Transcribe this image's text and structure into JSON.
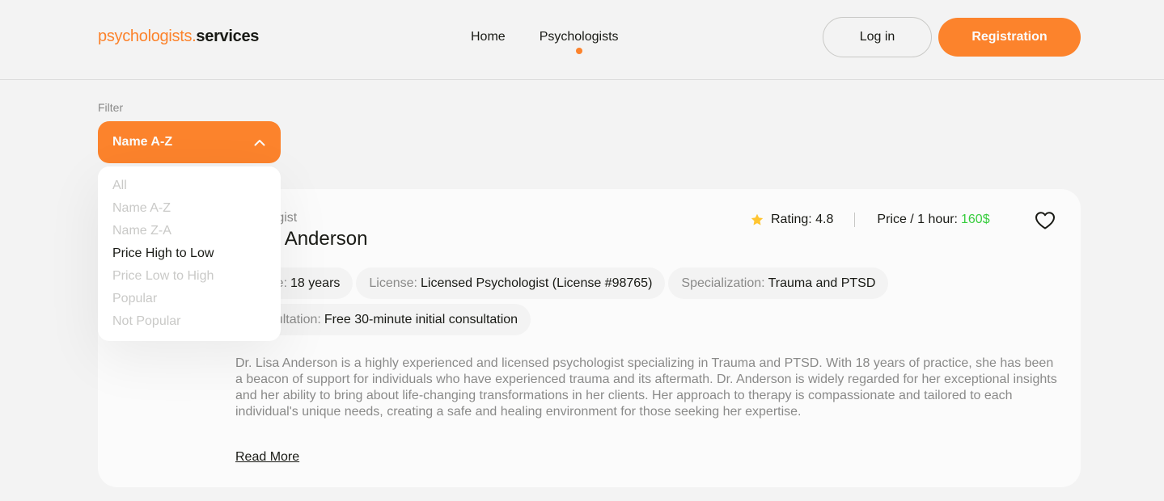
{
  "header": {
    "logo_part1": "psychologists.",
    "logo_part2": "services",
    "nav": [
      {
        "label": "Home"
      },
      {
        "label": "Psychologists"
      }
    ],
    "login_label": "Log in",
    "register_label": "Registration"
  },
  "filter": {
    "label": "Filter",
    "selected": "Name A-Z",
    "options": [
      "All",
      "Name A-Z",
      "Name Z-A",
      "Price High to Low",
      "Price Low to High",
      "Popular",
      "Not Popular"
    ],
    "hovered_option": "Price High to Low"
  },
  "card": {
    "role": "ologist",
    "name": "sa Anderson",
    "rating_label": "Rating: 4.8",
    "price_label": "Price / 1 hour:",
    "price_value": "160$",
    "tags": [
      {
        "key": "rience:",
        "value": "18 years"
      },
      {
        "key": "License:",
        "value": "Licensed Psychologist (License #98765)"
      },
      {
        "key": "Specialization:",
        "value": "Trauma and PTSD"
      },
      {
        "key": "consultation:",
        "value": "Free 30-minute initial consultation"
      }
    ],
    "description": "Dr. Lisa Anderson is a highly experienced and licensed psychologist specializing in Trauma and PTSD. With 18 years of practice, she has been a beacon of support for individuals who have experienced trauma and its aftermath. Dr. Anderson is widely regarded for her exceptional insights and her ability to bring about life-changing transformations in her clients. Her approach to therapy is compassionate and tailored to each individual's unique needs, creating a safe and healing environment for those seeking her expertise.",
    "read_more": "Read More"
  },
  "colors": {
    "accent": "#fc832c",
    "price": "#38cd3e",
    "star": "#ffc531",
    "background": "#f3f3f3"
  },
  "icons": [
    "chevron-up-icon",
    "star-icon",
    "heart-icon"
  ]
}
